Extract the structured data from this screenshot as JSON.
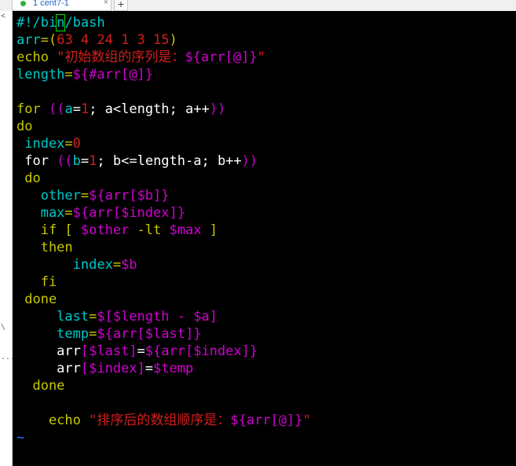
{
  "tab": {
    "title": "1 cent7-1",
    "close_glyph": "×",
    "status_color": "#2fb344"
  },
  "add_tab": "+",
  "left_strip": {
    "chars": [
      "<",
      "\\",
      "..."
    ]
  },
  "colors": {
    "cyan": "#00c8c8",
    "magenta": "#d200d2",
    "yellow": "#c8c800",
    "red": "#d21e1e",
    "white": "#ffffff",
    "blue": "#1e78ff",
    "cursor": "#00e000"
  },
  "code_lines": [
    [
      {
        "t": "#!/bi",
        "c": "cyan"
      },
      {
        "t": "n",
        "c": "cyan",
        "cursor": true
      },
      {
        "t": "/bash",
        "c": "cyan"
      }
    ],
    [
      {
        "t": "arr",
        "c": "cyan"
      },
      {
        "t": "=(",
        "c": "yellow"
      },
      {
        "t": "63 4 24 1 3 15",
        "c": "red"
      },
      {
        "t": ")",
        "c": "yellow"
      }
    ],
    [
      {
        "t": "echo ",
        "c": "yellow"
      },
      {
        "t": "\"初始数组的序列是：",
        "c": "red"
      },
      {
        "t": "${arr[@]}",
        "c": "magenta"
      },
      {
        "t": "\"",
        "c": "red"
      }
    ],
    [
      {
        "t": "length",
        "c": "cyan"
      },
      {
        "t": "=",
        "c": "yellow"
      },
      {
        "t": "${#arr[@]}",
        "c": "magenta"
      }
    ],
    [],
    [
      {
        "t": "for ",
        "c": "yellow"
      },
      {
        "t": "((",
        "c": "magenta"
      },
      {
        "t": "a",
        "c": "cyan"
      },
      {
        "t": "=",
        "c": "white"
      },
      {
        "t": "1",
        "c": "red"
      },
      {
        "t": "; a<length; a++",
        "c": "white"
      },
      {
        "t": "))",
        "c": "magenta"
      }
    ],
    [
      {
        "t": "do",
        "c": "yellow"
      }
    ],
    [
      {
        "t": " index",
        "c": "cyan"
      },
      {
        "t": "=",
        "c": "yellow"
      },
      {
        "t": "0",
        "c": "red"
      }
    ],
    [
      {
        "t": " for ",
        "c": "white"
      },
      {
        "t": "((",
        "c": "magenta"
      },
      {
        "t": "b",
        "c": "cyan"
      },
      {
        "t": "=",
        "c": "white"
      },
      {
        "t": "1",
        "c": "red"
      },
      {
        "t": "; b<=length-a; b++",
        "c": "white"
      },
      {
        "t": "))",
        "c": "magenta"
      }
    ],
    [
      {
        "t": " do",
        "c": "yellow"
      }
    ],
    [
      {
        "t": "   other",
        "c": "cyan"
      },
      {
        "t": "=",
        "c": "yellow"
      },
      {
        "t": "${arr[$b]}",
        "c": "magenta"
      }
    ],
    [
      {
        "t": "   max",
        "c": "cyan"
      },
      {
        "t": "=",
        "c": "yellow"
      },
      {
        "t": "${arr[$index]}",
        "c": "magenta"
      }
    ],
    [
      {
        "t": "   if [ ",
        "c": "yellow"
      },
      {
        "t": "$other",
        "c": "magenta"
      },
      {
        "t": " -lt ",
        "c": "yellow"
      },
      {
        "t": "$max",
        "c": "magenta"
      },
      {
        "t": " ]",
        "c": "yellow"
      }
    ],
    [
      {
        "t": "   then",
        "c": "yellow"
      }
    ],
    [
      {
        "t": "       index",
        "c": "cyan"
      },
      {
        "t": "=",
        "c": "yellow"
      },
      {
        "t": "$b",
        "c": "magenta"
      }
    ],
    [
      {
        "t": "   fi",
        "c": "yellow"
      }
    ],
    [
      {
        "t": " done",
        "c": "yellow"
      }
    ],
    [
      {
        "t": "     last",
        "c": "cyan"
      },
      {
        "t": "=",
        "c": "yellow"
      },
      {
        "t": "$[$length - $a]",
        "c": "magenta"
      }
    ],
    [
      {
        "t": "     temp",
        "c": "cyan"
      },
      {
        "t": "=",
        "c": "yellow"
      },
      {
        "t": "${arr[$last]}",
        "c": "magenta"
      }
    ],
    [
      {
        "t": "     arr",
        "c": "white"
      },
      {
        "t": "[$last]",
        "c": "magenta"
      },
      {
        "t": "=",
        "c": "white"
      },
      {
        "t": "${arr[$index]}",
        "c": "magenta"
      }
    ],
    [
      {
        "t": "     arr",
        "c": "white"
      },
      {
        "t": "[$index]",
        "c": "magenta"
      },
      {
        "t": "=",
        "c": "white"
      },
      {
        "t": "$temp",
        "c": "magenta"
      }
    ],
    [
      {
        "t": "  done",
        "c": "yellow"
      }
    ],
    [],
    [
      {
        "t": "    echo ",
        "c": "yellow"
      },
      {
        "t": "\"排序后的数组顺序是：",
        "c": "red"
      },
      {
        "t": "${arr[@]}",
        "c": "magenta"
      },
      {
        "t": "\"",
        "c": "red"
      }
    ],
    [
      {
        "t": "~",
        "c": "blue"
      }
    ]
  ]
}
